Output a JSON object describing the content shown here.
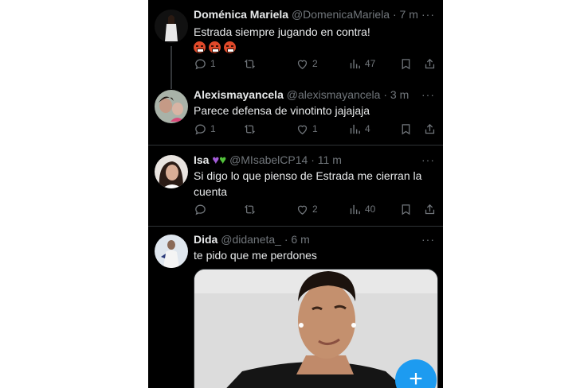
{
  "tweets": [
    {
      "name": "Doménica Mariela",
      "handle": "@DomenicaMariela",
      "time": "· 7 m",
      "text": "Estrada siempre jugando en contra!",
      "emoji": [
        "angry-face",
        "angry-face",
        "angry-face"
      ],
      "replies": "1",
      "retweets": "",
      "likes": "2",
      "views": "47"
    },
    {
      "name": "Alexismayancela",
      "handle": "@alexismayancela",
      "time": "· 3 m",
      "text": "Parece defensa de vinotinto jajajaja",
      "replies": "1",
      "retweets": "",
      "likes": "1",
      "views": "4"
    },
    {
      "name": "Isa",
      "name_emoji": [
        "purple-heart",
        "green-heart"
      ],
      "handle": "@MIsabelCP14",
      "time": "· 11 m",
      "text": "Si digo lo que pienso de Estrada me cierran la cuenta",
      "replies": "",
      "retweets": "",
      "likes": "2",
      "views": "40"
    },
    {
      "name": "Dida",
      "handle": "@didaneta_",
      "time": "· 6 m",
      "text": "te pido que me perdones"
    }
  ],
  "more_label": "···",
  "fab_label": "+",
  "colors": {
    "background": "#000000",
    "text": "#e7e9ea",
    "muted": "#71767b",
    "accent": "#1d9bf0",
    "divider": "#2f3336"
  }
}
